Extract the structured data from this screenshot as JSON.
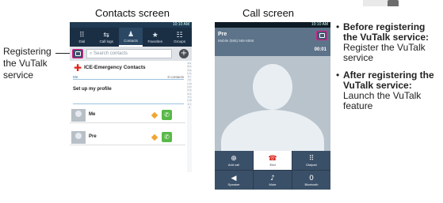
{
  "captions": {
    "contacts": "Contacts screen",
    "call": "Call screen"
  },
  "left_label": [
    "Registering",
    "the VuTalk",
    "service"
  ],
  "contacts": {
    "status_time": "10:10 AM",
    "tabs": [
      {
        "label": "Dial",
        "icon": "dial-icon",
        "glyph": "⠿"
      },
      {
        "label": "Call logs",
        "icon": "call-logs-icon",
        "glyph": "⇆"
      },
      {
        "label": "Contacts",
        "icon": "contacts-icon",
        "glyph": "♟"
      },
      {
        "label": "Favorites",
        "icon": "favorites-icon",
        "glyph": "★"
      },
      {
        "label": "Groups",
        "icon": "groups-icon",
        "glyph": "☷"
      }
    ],
    "search_placeholder": "Search contacts",
    "ice_label": "ICE-Emergency Contacts",
    "section_me": "Me",
    "section_me_count": "0 contacts",
    "profile_label": "Set up my profile",
    "rows": [
      {
        "name": "Me"
      },
      {
        "name": "Pre"
      }
    ],
    "index_letters": "# A B C D E F G H I J K L M N O P Q R S T U V W X Y Z"
  },
  "call": {
    "status_time": "10:10 AM",
    "name": "Pre",
    "number": "Mobile (555) 555-5555",
    "timer": "00:01",
    "buttons": [
      {
        "label": "Add call",
        "icon": "add-call-icon",
        "glyph": "⊕"
      },
      {
        "label": "End",
        "icon": "end-call-icon",
        "glyph": "☎"
      },
      {
        "label": "Dialpad",
        "icon": "dialpad-icon",
        "glyph": "⠿"
      },
      {
        "label": "Speaker",
        "icon": "speaker-icon",
        "glyph": "◀"
      },
      {
        "label": "Mute",
        "icon": "mute-icon",
        "glyph": "♪"
      },
      {
        "label": "Bluetooth",
        "icon": "bluetooth-icon",
        "glyph": "0"
      }
    ]
  },
  "bullets": [
    {
      "heading": "Before registering the VuTalk service:",
      "body": "Register the VuTalk service"
    },
    {
      "heading": "After registering the VuTalk service:",
      "body": "Launch the VuTalk feature"
    }
  ]
}
